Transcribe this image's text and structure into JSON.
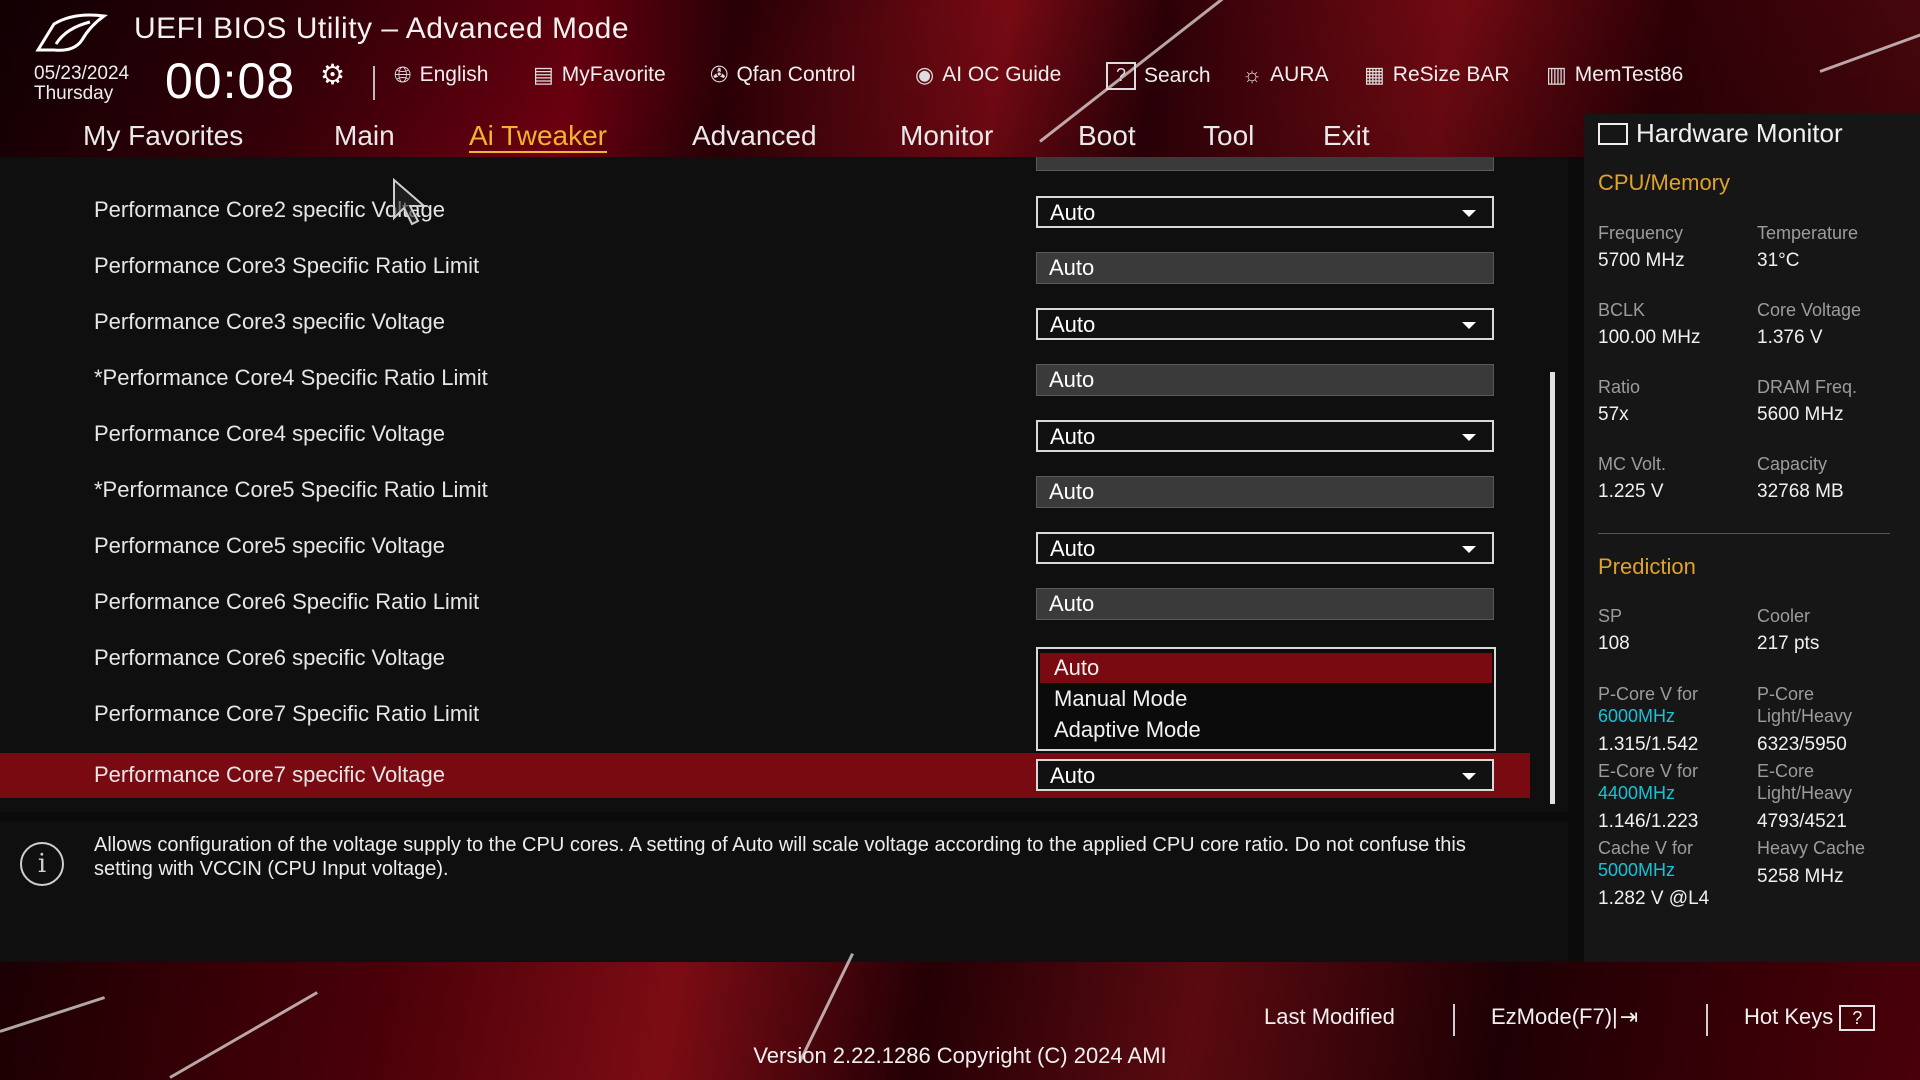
{
  "header": {
    "title": "UEFI BIOS Utility – Advanced Mode",
    "date": "05/23/2024",
    "weekday": "Thursday",
    "time": "00:08",
    "tools": [
      {
        "label": "English",
        "icon": "globe-icon"
      },
      {
        "label": "MyFavorite",
        "icon": "favorite-icon"
      },
      {
        "label": "Qfan Control",
        "icon": "fan-icon"
      },
      {
        "label": "AI OC Guide",
        "icon": "ai-icon"
      },
      {
        "label": "Search",
        "icon": "search-icon"
      },
      {
        "label": "AURA",
        "icon": "aura-icon"
      },
      {
        "label": "ReSize BAR",
        "icon": "resize-bar-icon"
      },
      {
        "label": "MemTest86",
        "icon": "memtest-icon"
      }
    ]
  },
  "menu": [
    {
      "label": "My Favorites"
    },
    {
      "label": "Main"
    },
    {
      "label": "Ai Tweaker",
      "active": true
    },
    {
      "label": "Advanced"
    },
    {
      "label": "Monitor"
    },
    {
      "label": "Boot"
    },
    {
      "label": "Tool"
    },
    {
      "label": "Exit"
    }
  ],
  "settings": [
    {
      "label": "Performance Core2 specific Voltage",
      "value": "Auto",
      "type": "dropdown"
    },
    {
      "label": "Performance Core3 Specific Ratio Limit",
      "value": "Auto",
      "type": "fixed"
    },
    {
      "label": "Performance Core3 specific Voltage",
      "value": "Auto",
      "type": "dropdown"
    },
    {
      "label": "*Performance Core4 Specific Ratio Limit",
      "value": "Auto",
      "type": "fixed"
    },
    {
      "label": "Performance Core4 specific Voltage",
      "value": "Auto",
      "type": "dropdown"
    },
    {
      "label": "*Performance Core5 Specific Ratio Limit",
      "value": "Auto",
      "type": "fixed"
    },
    {
      "label": "Performance Core5 specific Voltage",
      "value": "Auto",
      "type": "dropdown"
    },
    {
      "label": "Performance Core6 Specific Ratio Limit",
      "value": "Auto",
      "type": "fixed"
    },
    {
      "label": "Performance Core6 specific Voltage",
      "value": "",
      "type": "hidden"
    },
    {
      "label": "Performance Core7 Specific Ratio Limit",
      "value": "",
      "type": "hidden"
    },
    {
      "label": "Performance Core7 specific Voltage",
      "value": "Auto",
      "type": "dropdown",
      "selected": true
    }
  ],
  "dropdown_options": [
    "Auto",
    "Manual Mode",
    "Adaptive Mode"
  ],
  "dropdown_highlighted": "Auto",
  "help_text": "Allows configuration of the voltage supply to the CPU cores. A setting of Auto will scale voltage according to the applied CPU core ratio.  Do not confuse this setting with VCCIN (CPU Input voltage).",
  "hardware_monitor": {
    "title": "Hardware Monitor",
    "cpu_memory_title": "CPU/Memory",
    "frequency_label": "Frequency",
    "frequency": "5700 MHz",
    "temperature_label": "Temperature",
    "temperature": "31°C",
    "bclk_label": "BCLK",
    "bclk": "100.00 MHz",
    "core_voltage_label": "Core Voltage",
    "core_voltage": "1.376 V",
    "ratio_label": "Ratio",
    "ratio": "57x",
    "dram_freq_label": "DRAM Freq.",
    "dram_freq": "5600 MHz",
    "mc_volt_label": "MC Volt.",
    "mc_volt": "1.225 V",
    "capacity_label": "Capacity",
    "capacity": "32768 MB",
    "prediction_title": "Prediction",
    "sp_label": "SP",
    "sp": "108",
    "cooler_label": "Cooler",
    "cooler": "217 pts",
    "pcore_v_label": "P-Core V for",
    "pcore_v_freq": "6000MHz",
    "pcore_v": "1.315/1.542",
    "pcore_lh_label1": "P-Core",
    "pcore_lh_label2": "Light/Heavy",
    "pcore_lh": "6323/5950",
    "ecore_v_label": "E-Core V for",
    "ecore_v_freq": "4400MHz",
    "ecore_v": "1.146/1.223",
    "ecore_lh_label1": "E-Core",
    "ecore_lh_label2": "Light/Heavy",
    "ecore_lh": "4793/4521",
    "cache_v_label": "Cache V for",
    "cache_v_freq": "5000MHz",
    "cache_v": "1.282 V @L4",
    "heavy_cache_label": "Heavy Cache",
    "heavy_cache": "5258 MHz"
  },
  "footer": {
    "last_modified": "Last Modified",
    "ezmode": "EzMode(F7)|",
    "hotkeys": "Hot Keys",
    "version": "Version 2.22.1286 Copyright (C) 2024 AMI"
  },
  "colors": {
    "accent": "#f0b52e",
    "selection": "#7a0a12",
    "prediction_freq": "#18c1d6"
  }
}
